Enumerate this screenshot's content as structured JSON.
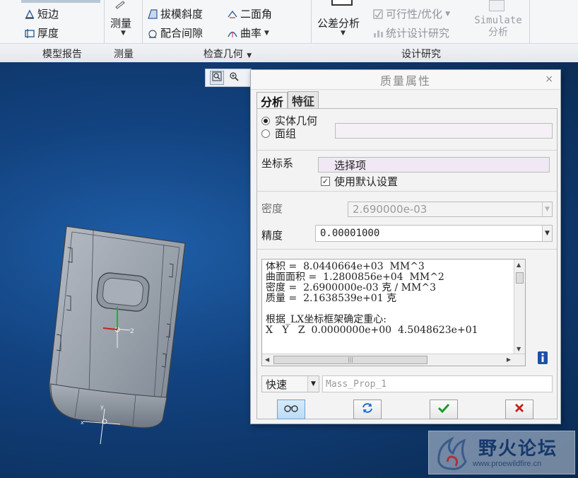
{
  "ribbon": {
    "buttons": {
      "short_edge": "短边",
      "thickness": "厚度",
      "measure": "测量",
      "draft": "拔模斜度",
      "dihedral": "二面角",
      "clearance": "配合间隙",
      "curvature": "曲率",
      "tolerance": "公差分析",
      "feasibility": "可行性/优化",
      "statistical": "统计设计研究",
      "simulate_line1": "Simulate",
      "simulate_line2": "分析"
    },
    "groups": {
      "model_report": "模型报告",
      "measure": "测量",
      "inspect_geometry": "检查几何",
      "design_study": "设计研究"
    }
  },
  "dialog": {
    "title": "质量属性",
    "close": "×",
    "tabs": [
      "分析",
      "特征"
    ],
    "radio_solid": "实体几何",
    "radio_quilt": "面组",
    "coord_label": "坐标系",
    "coord_value": "选择项",
    "use_default": "使用默认设置",
    "density_label": "密度",
    "density_value": "2.690000e-03",
    "accuracy_label": "精度",
    "accuracy_value": "0.00001000",
    "results": "体积 =  8.0440664e+03  MM^3\n曲面面积 =  1.2800856e+04  MM^2\n密度 =  2.6900000e-03 克 / MM^3\n质量 =  2.1638539e+01 克\n\n根据_LX坐标框架确定重心:\nX   Y   Z  0.0000000e+00  4.5048623e+01",
    "mode_value": "快速",
    "name_value": "Mass_Prop_1"
  },
  "watermark": {
    "title": "野火论坛",
    "url": "www.proewildfire.cn"
  },
  "colors": {
    "viewport_dark": "#0a2950",
    "viewport_light": "#1f5fa8",
    "ok_green": "#1f9a2d",
    "cancel_red": "#c8201e",
    "info_blue": "#1d4fa8"
  }
}
